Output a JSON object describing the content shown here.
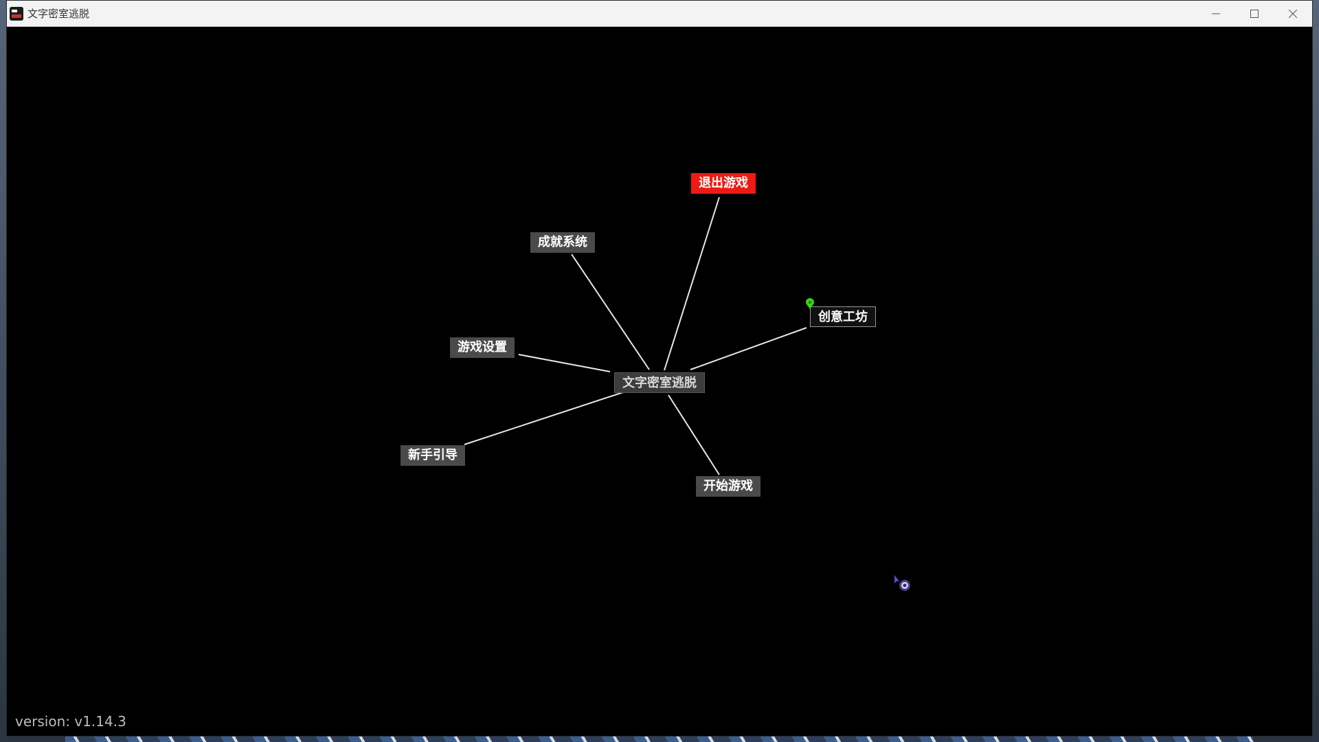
{
  "window": {
    "title": "文字密室逃脱",
    "controls": {
      "minimize_icon": "minimize-icon",
      "maximize_icon": "maximize-icon",
      "close_icon": "close-icon"
    }
  },
  "menu": {
    "center": "文字密室逃脱",
    "items": [
      {
        "id": "exit-game",
        "label": "退出游戏",
        "style": "danger",
        "color": "#ef1a12"
      },
      {
        "id": "achievements",
        "label": "成就系统",
        "style": "normal"
      },
      {
        "id": "workshop",
        "label": "创意工坊",
        "style": "outlined",
        "indicator": "green-pin-icon",
        "indicator_color": "#3ecf1a"
      },
      {
        "id": "settings",
        "label": "游戏设置",
        "style": "normal"
      },
      {
        "id": "tutorial",
        "label": "新手引导",
        "style": "normal"
      },
      {
        "id": "start-game",
        "label": "开始游戏",
        "style": "normal"
      }
    ]
  },
  "footer": {
    "version": "version: v1.14.3"
  },
  "colors": {
    "background": "#000000",
    "node": "#4a4a4a",
    "danger": "#ef1a12",
    "link": "#e8e8e8",
    "indicator": "#3ecf1a"
  }
}
